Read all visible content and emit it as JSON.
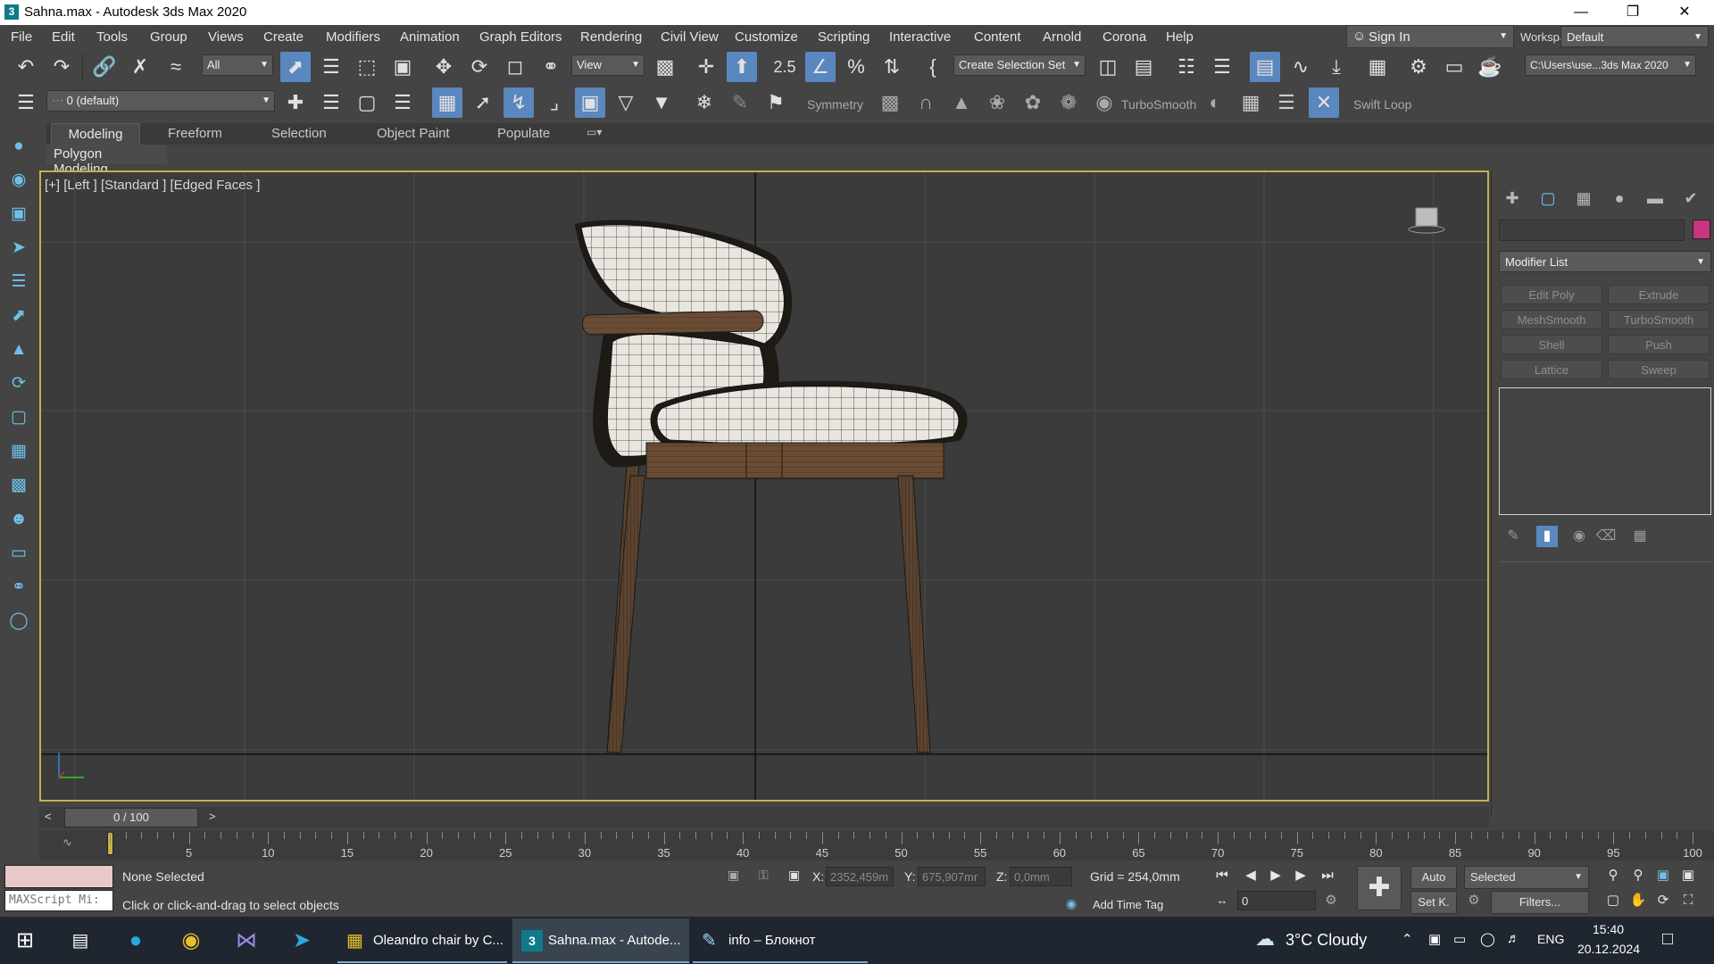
{
  "window": {
    "title": "Sahna.max - Autodesk 3ds Max 2020",
    "app_icon": "3"
  },
  "menu": [
    "File",
    "Edit",
    "Tools",
    "Group",
    "Views",
    "Create",
    "Modifiers",
    "Animation",
    "Graph Editors",
    "Rendering",
    "Civil View",
    "Customize",
    "Scripting",
    "Interactive",
    "Content",
    "Arnold",
    "Corona",
    "Help"
  ],
  "account": {
    "sign_in": "Sign In",
    "workspaces_label": "Workspaces:",
    "workspace": "Default"
  },
  "toolbar": {
    "filter": "All",
    "ref_coord": "View",
    "selection_set": "Create Selection Set",
    "project_path": "C:\\Users\\use...3ds Max 2020",
    "layer": "0 (default)",
    "symmetry": "Symmetry",
    "turbosmooth": "TurboSmooth",
    "swift_loop": "Swift Loop",
    "snap_25": "2.5"
  },
  "ribbon": {
    "tabs": [
      "Modeling",
      "Freeform",
      "Selection",
      "Object Paint",
      "Populate"
    ],
    "panel": "Polygon Modeling"
  },
  "viewport": {
    "label": "[+] [Left ] [Standard ] [Edged Faces ]",
    "viewcube_face": "left"
  },
  "command_panel": {
    "modifier_list": "Modifier List",
    "modifier_buttons": [
      "Edit Poly",
      "Extrude",
      "MeshSmooth",
      "TurboSmooth",
      "Shell",
      "Push",
      "Lattice",
      "Sweep"
    ],
    "object_color": "#c8357c"
  },
  "timeline": {
    "frame": "0 / 100",
    "ticks": [
      "5",
      "10",
      "15",
      "20",
      "25",
      "30",
      "35",
      "40",
      "45",
      "50",
      "55",
      "60",
      "65",
      "70",
      "75",
      "80",
      "85",
      "90",
      "95",
      "100"
    ]
  },
  "status": {
    "maxscript": "MAXScript Mi:",
    "selection": "None Selected",
    "prompt": "Click or click-and-drag to select objects",
    "x_label": "X:",
    "x": "2352,459m",
    "y_label": "Y:",
    "y": "675,907mr",
    "z_label": "Z:",
    "z": "0,0mm",
    "grid": "Grid = 254,0mm",
    "add_time_tag": "Add Time Tag",
    "auto_key": "Auto",
    "set_key": "Set K.",
    "key_filter": "Selected",
    "filters": "Filters...",
    "current_frame": "0"
  },
  "taskbar": {
    "tasks": [
      "Oleandro chair by C...",
      "Sahna.max - Autode...",
      "info – Блокнот"
    ],
    "weather": "3°C  Cloudy",
    "lang": "ENG",
    "time": "15:40",
    "date": "20.12.2024"
  }
}
